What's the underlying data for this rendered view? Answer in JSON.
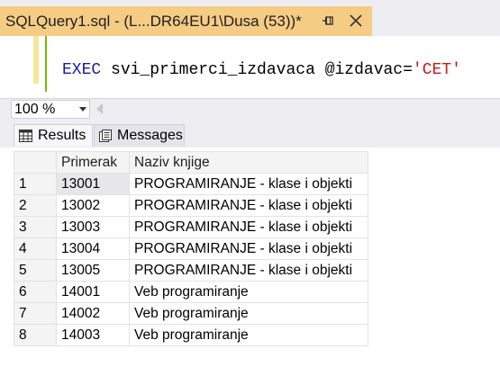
{
  "tab": {
    "title": "SQLQuery1.sql - (L...DR64EU1\\Dusa (53))*",
    "pin_icon": "pin-icon",
    "close_icon": "close-icon"
  },
  "editor": {
    "keyword": "EXEC",
    "procedure": "svi_primerci_izdavaca",
    "parameter": "@izdavac=",
    "string_value": "'CET'"
  },
  "zoom": {
    "value": "100 %"
  },
  "results_tabs": [
    {
      "label": "Results",
      "icon": "grid-icon"
    },
    {
      "label": "Messages",
      "icon": "messages-icon"
    }
  ],
  "grid": {
    "columns": [
      "",
      "Primerak",
      "Naziv knjige"
    ],
    "rows": [
      {
        "n": "1",
        "primerak": "13001",
        "naziv": "PROGRAMIRANJE - klase i objekti"
      },
      {
        "n": "2",
        "primerak": "13002",
        "naziv": "PROGRAMIRANJE - klase i objekti"
      },
      {
        "n": "3",
        "primerak": "13003",
        "naziv": "PROGRAMIRANJE - klase i objekti"
      },
      {
        "n": "4",
        "primerak": "13004",
        "naziv": "PROGRAMIRANJE - klase i objekti"
      },
      {
        "n": "5",
        "primerak": "13005",
        "naziv": "PROGRAMIRANJE - klase i objekti"
      },
      {
        "n": "6",
        "primerak": "14001",
        "naziv": "Veb programiranje"
      },
      {
        "n": "7",
        "primerak": "14002",
        "naziv": "Veb programiranje"
      },
      {
        "n": "8",
        "primerak": "14003",
        "naziv": "Veb programiranje"
      }
    ]
  },
  "colors": {
    "tab_active": "#f5cc84",
    "keyword": "#1a1aa6",
    "string": "#c41a16"
  }
}
